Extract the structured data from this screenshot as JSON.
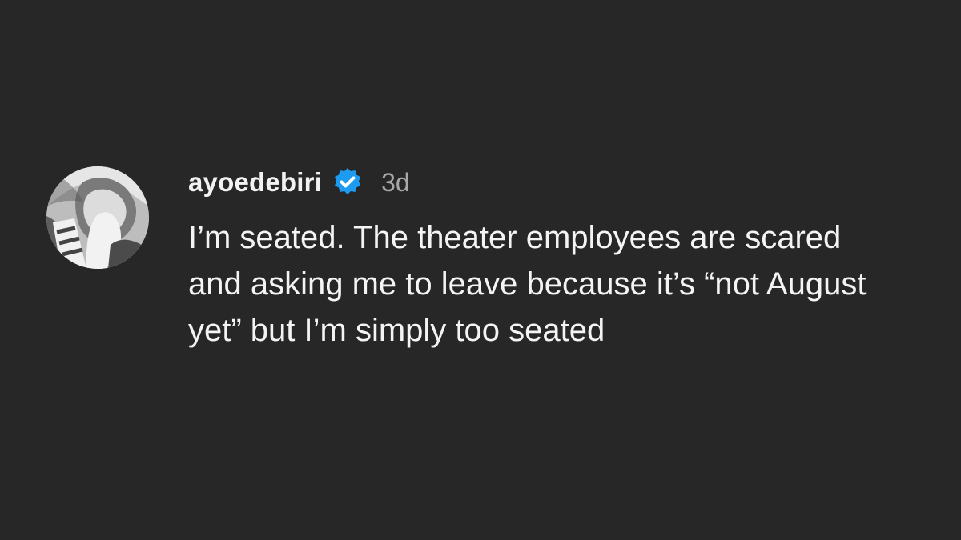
{
  "comment": {
    "username": "ayoedebiri",
    "timestamp": "3d",
    "text": "I’m seated. The theater employees are scared and asking me to leave because it’s “not August yet” but I’m simply too seated",
    "avatar_icon": "profile-photo-icon",
    "verified_icon": "verified-badge-icon"
  },
  "colors": {
    "background": "#272727",
    "text": "#f4f4f4",
    "timestamp": "#a8a8a8",
    "verified": "#1d9bf0"
  }
}
